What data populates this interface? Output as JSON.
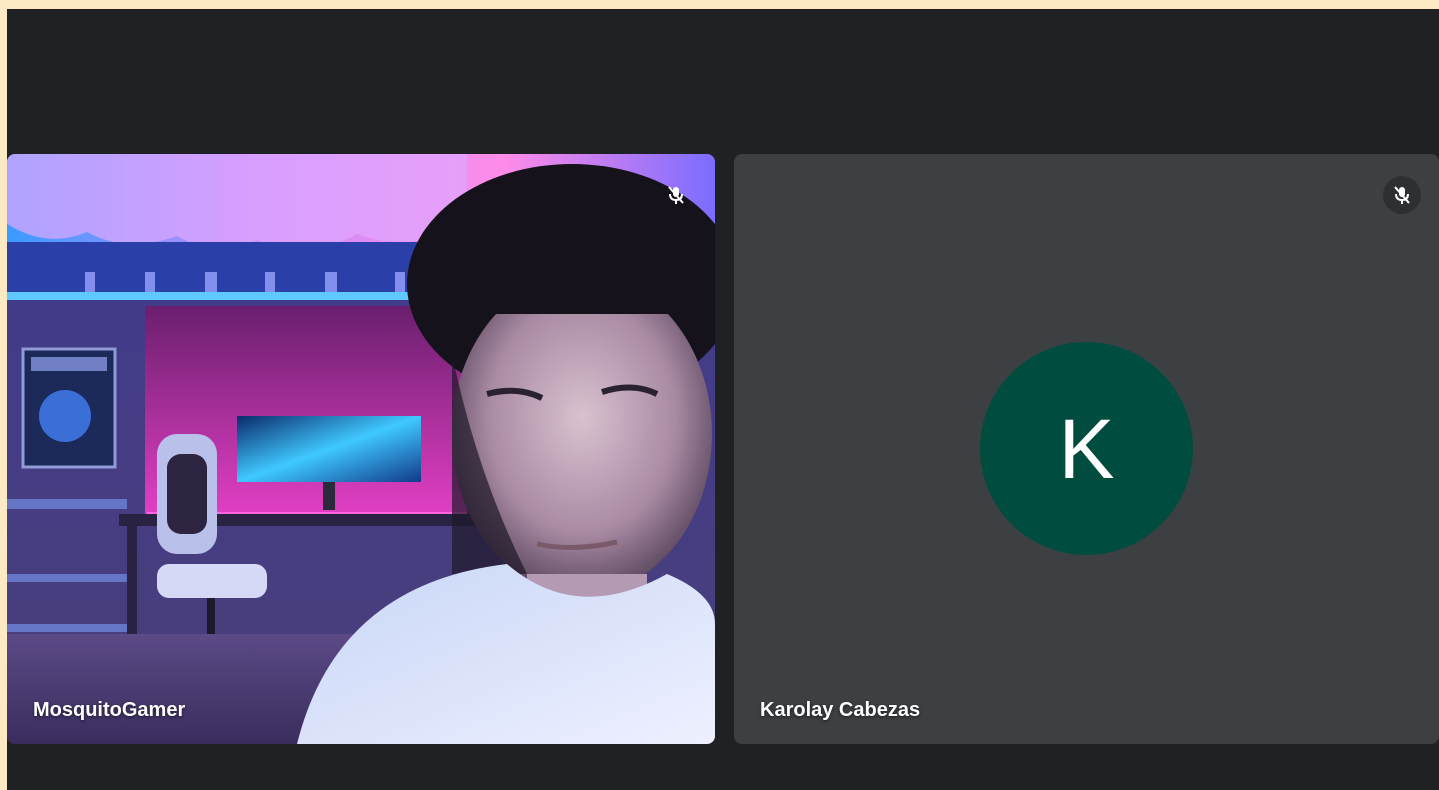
{
  "meeting": {
    "participants": [
      {
        "name": "MosquitoGamer",
        "muted": true,
        "video": "camera-feed",
        "mic_icon": "mic-off-icon"
      },
      {
        "name": "Karolay Cabezas",
        "muted": true,
        "video": "off",
        "avatar_letter": "K",
        "avatar_color": "#004d40",
        "mic_icon": "mic-off-icon"
      }
    ]
  },
  "colors": {
    "page_border": "#fde9c4",
    "background": "#202124",
    "tile_background": "#3c4043"
  }
}
